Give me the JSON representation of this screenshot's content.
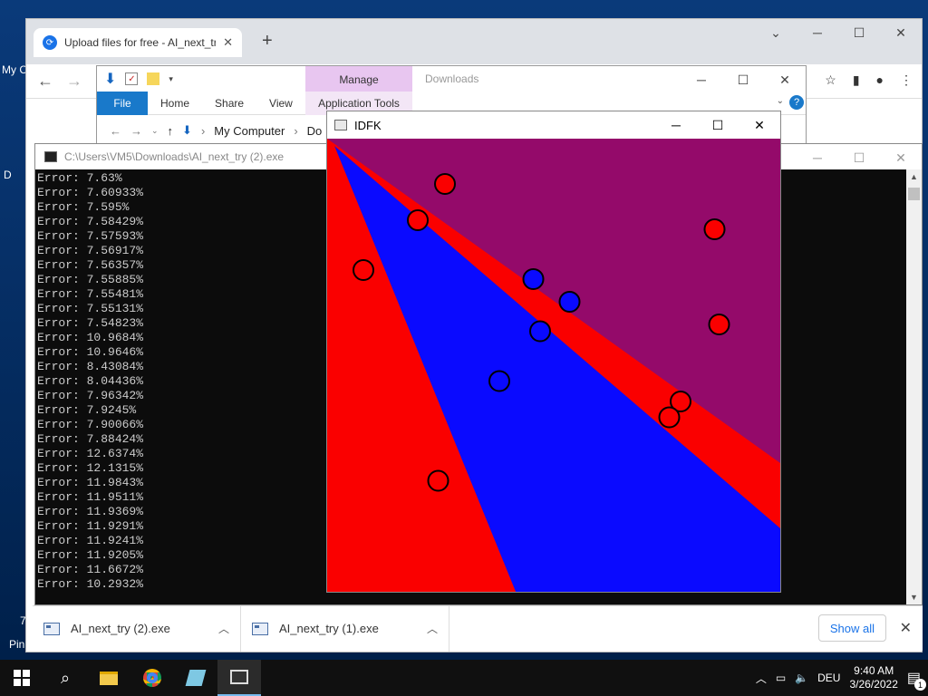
{
  "desktop": {
    "fragments": [
      "My C",
      "D",
      "7",
      "Pin"
    ]
  },
  "chrome": {
    "tab_title": "Upload files for free - AI_next_try",
    "tab_close": "✕",
    "new_tab": "+",
    "downloads": [
      {
        "name": "AI_next_try (2).exe"
      },
      {
        "name": "AI_next_try (1).exe"
      }
    ],
    "show_all": "Show all",
    "close_bar": "✕"
  },
  "explorer": {
    "manage": "Manage",
    "title": "Downloads",
    "ribbon": {
      "file": "File",
      "tabs": [
        "Home",
        "Share",
        "View"
      ],
      "app_tools": "Application Tools"
    },
    "address": {
      "crumb1": "My Computer",
      "crumb2": "Do"
    }
  },
  "console": {
    "title": "C:\\Users\\VM5\\Downloads\\AI_next_try (2).exe",
    "lines": [
      "Error: 7.63%",
      "Error: 7.60933%",
      "Error: 7.595%",
      "Error: 7.58429%",
      "Error: 7.57593%",
      "Error: 7.56917%",
      "Error: 7.56357%",
      "Error: 7.55885%",
      "Error: 7.55481%",
      "Error: 7.55131%",
      "Error: 7.54823%",
      "Error: 10.9684%",
      "Error: 10.9646%",
      "Error: 8.43084%",
      "Error: 8.04436%",
      "Error: 7.96342%",
      "Error: 7.9245%",
      "Error: 7.90066%",
      "Error: 7.88424%",
      "Error: 12.6374%",
      "Error: 12.1315%",
      "Error: 11.9843%",
      "Error: 11.9511%",
      "Error: 11.9369%",
      "Error: 11.9291%",
      "Error: 11.9241%",
      "Error: 11.9205%",
      "Error: 11.6672%",
      "Error: 10.2932%"
    ]
  },
  "idfk": {
    "title": "IDFK",
    "colors": {
      "purple": "#940a6a",
      "red": "#fa0000",
      "blue": "#0a0aff"
    },
    "points": [
      {
        "cls": "red",
        "x": 0.26,
        "y": 0.1
      },
      {
        "cls": "red",
        "x": 0.2,
        "y": 0.18
      },
      {
        "cls": "red",
        "x": 0.855,
        "y": 0.2
      },
      {
        "cls": "red",
        "x": 0.08,
        "y": 0.29
      },
      {
        "cls": "blue",
        "x": 0.455,
        "y": 0.31
      },
      {
        "cls": "blue",
        "x": 0.535,
        "y": 0.36
      },
      {
        "cls": "red",
        "x": 0.865,
        "y": 0.41
      },
      {
        "cls": "blue",
        "x": 0.47,
        "y": 0.425
      },
      {
        "cls": "blue",
        "x": 0.38,
        "y": 0.535
      },
      {
        "cls": "red",
        "x": 0.78,
        "y": 0.58
      },
      {
        "cls": "red",
        "x": 0.755,
        "y": 0.615
      },
      {
        "cls": "red",
        "x": 0.245,
        "y": 0.755
      }
    ]
  },
  "taskbar": {
    "lang": "DEU",
    "time": "9:40 AM",
    "date": "3/26/2022",
    "notif": "1"
  }
}
